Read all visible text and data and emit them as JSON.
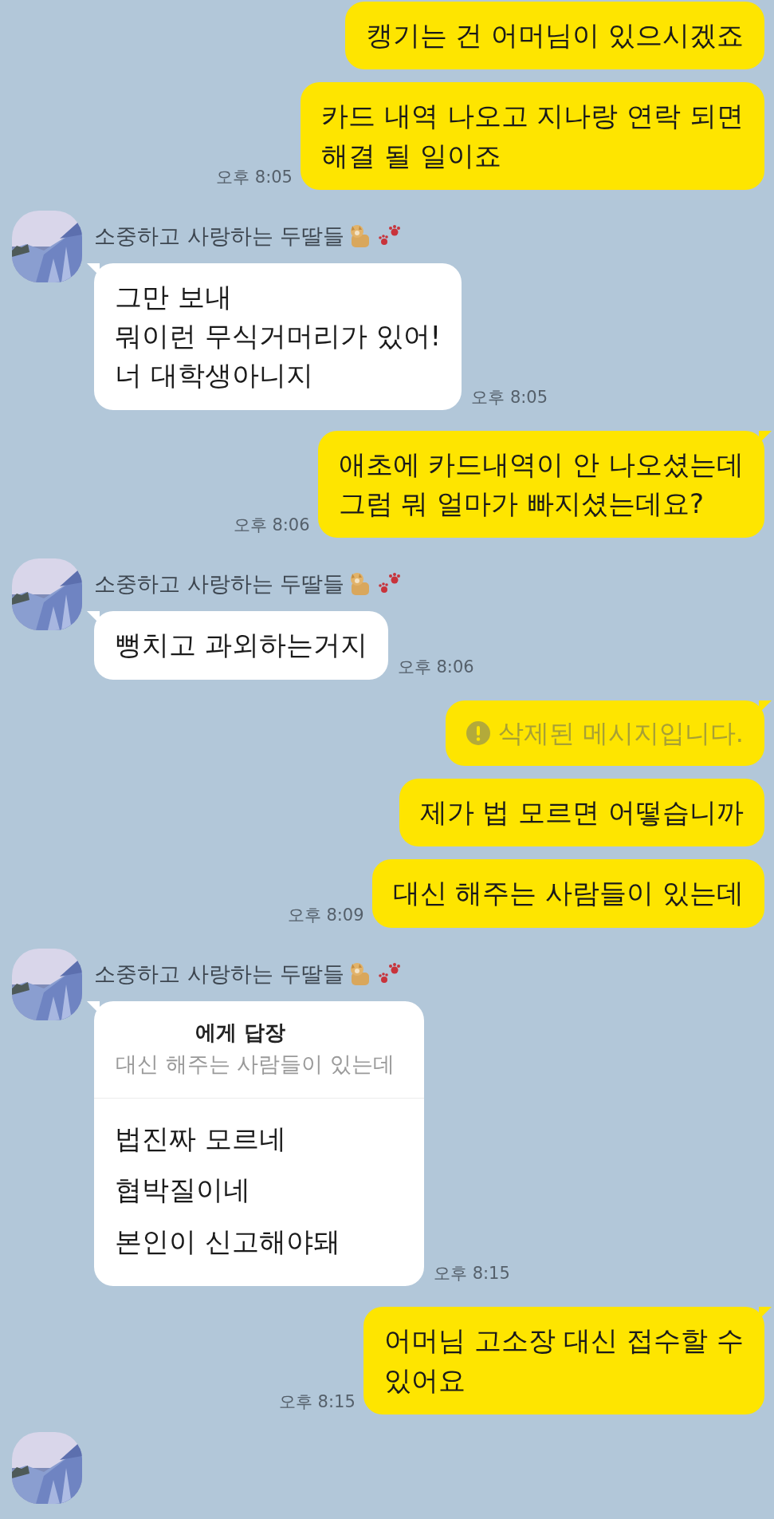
{
  "messages": [
    {
      "kind": "sent",
      "text": "캥기는 건 어머님이 있으시겠죠"
    },
    {
      "kind": "sent",
      "text": "카드 내역 나오고 지나랑 연락 되면\n해결 될 일이죠",
      "time": "오후 8:05"
    },
    {
      "kind": "received",
      "sender": "소중하고 사랑하는 두딸들",
      "text": "그만 보내\n뭐이런 무식거머리가 있어!\n너 대학생아니지",
      "time": "오후 8:05"
    },
    {
      "kind": "sent",
      "text": "애초에 카드내역이 안 나오셨는데\n그럼 뭐 얼마가 빠지셨는데요?",
      "time": "오후 8:06"
    },
    {
      "kind": "received",
      "sender": "소중하고 사랑하는 두딸들",
      "text": "뻥치고 과외하는거지",
      "time": "오후 8:06"
    },
    {
      "kind": "sent_deleted",
      "text": "삭제된 메시지입니다."
    },
    {
      "kind": "sent",
      "text": "제가 법 모르면 어떻습니까"
    },
    {
      "kind": "sent",
      "text": "대신 해주는 사람들이 있는데",
      "time": "오후 8:09"
    },
    {
      "kind": "received_reply",
      "sender": "소중하고 사랑하는 두딸들",
      "reply_to": {
        "label": "에게 답장",
        "quote": "대신 해주는 사람들이 있는데"
      },
      "text": "법진짜 모르네\n협박질이네\n본인이 신고해야돼",
      "time": "오후 8:15"
    },
    {
      "kind": "sent",
      "text": "어머님 고소장 대신 접수할 수\n있어요",
      "time": "오후 8:15"
    },
    {
      "kind": "received_clipped"
    }
  ]
}
